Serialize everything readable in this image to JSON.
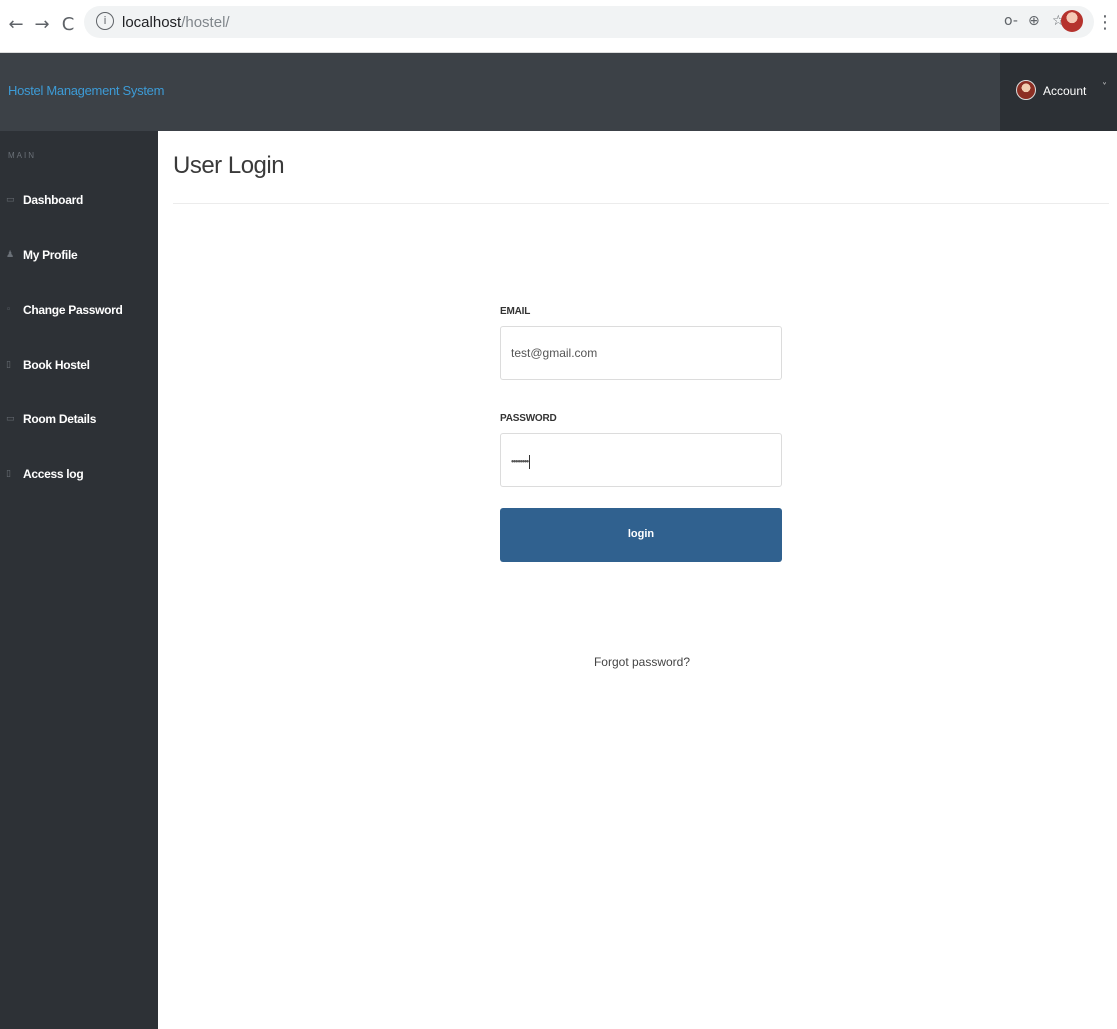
{
  "browser": {
    "url_host": "localhost",
    "url_path": "/hostel/",
    "back_glyph": "←",
    "forward_glyph": "→",
    "reload_glyph": "C",
    "info_glyph": "i",
    "key_glyph": "o-",
    "zoom_glyph": "⊕",
    "star_glyph": "☆",
    "menu_glyph": "⋮"
  },
  "header": {
    "brand": "Hostel Management System",
    "account_label": "Account",
    "account_caret": "˅"
  },
  "sidebar": {
    "section": "MAIN",
    "items": [
      {
        "label": "Dashboard",
        "icon": "monitor-icon",
        "glyph": "▭"
      },
      {
        "label": "My Profile",
        "icon": "user-icon",
        "glyph": "♟"
      },
      {
        "label": "Change Password",
        "icon": "lock-icon",
        "glyph": "◦"
      },
      {
        "label": "Book Hostel",
        "icon": "file-icon",
        "glyph": "▯"
      },
      {
        "label": "Room Details",
        "icon": "desktop-icon",
        "glyph": "▭"
      },
      {
        "label": "Access log",
        "icon": "log-icon",
        "glyph": "▯"
      }
    ]
  },
  "main": {
    "title": "User Login",
    "email_label": "EMAIL",
    "email_value": "test@gmail.com",
    "password_label": "PASSWORD",
    "password_value": "••••••••",
    "login_label": "login",
    "forgot_label": "Forgot password?"
  },
  "colors": {
    "header_bg": "#3c4147",
    "sidebar_bg": "#2d3136",
    "brand": "#3d9bd6",
    "button": "#30618f"
  }
}
